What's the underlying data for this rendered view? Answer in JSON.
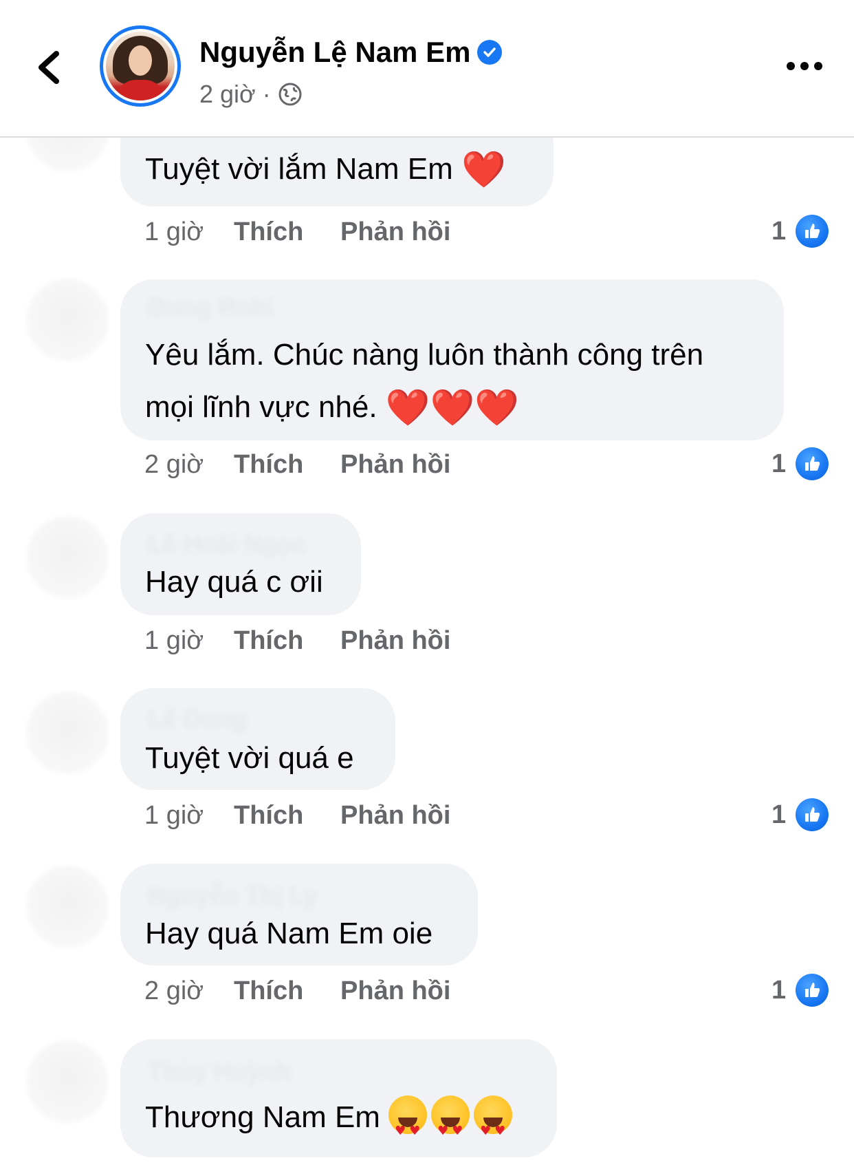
{
  "header": {
    "page_name": "Nguyễn Lệ Nam Em",
    "time": "2 giờ",
    "separator": "·"
  },
  "actions": {
    "like_label": "Thích",
    "reply_label": "Phản hồi"
  },
  "comments": [
    {
      "author": "",
      "line1": "Tuyệt vời lắm Nam Em ",
      "line2": "",
      "emoji": "❤️",
      "time": "1 giờ",
      "likes": "1"
    },
    {
      "author": "Dung Rubi",
      "line1": "Yêu lắm. Chúc nàng luôn thành công trên",
      "line2": "mọi lĩnh vực nhé. ",
      "emoji": "❤️❤️❤️",
      "time": "2 giờ",
      "likes": "1"
    },
    {
      "author": "Lê Hoài Ngọc",
      "line1": "Hay quá c ơii",
      "line2": "",
      "emoji": "",
      "time": "1 giờ",
      "likes": ""
    },
    {
      "author": "Lê Dung",
      "line1": "Tuyệt vời quá e",
      "line2": "",
      "emoji": "",
      "time": "1 giờ",
      "likes": "1"
    },
    {
      "author": "Nguyễn Thị Ly",
      "line1": "Hay quá Nam Em oie",
      "line2": "",
      "emoji": "",
      "time": "2 giờ",
      "likes": "1"
    },
    {
      "author": "Thủy Huỳnh",
      "line1": "Thương Nam Em ",
      "line2": "",
      "emoji": "😍😍😍",
      "time": "",
      "likes": ""
    }
  ],
  "colors": {
    "accent": "#1877f2",
    "bubble": "#f0f2f5",
    "secondary_text": "#65676b"
  }
}
